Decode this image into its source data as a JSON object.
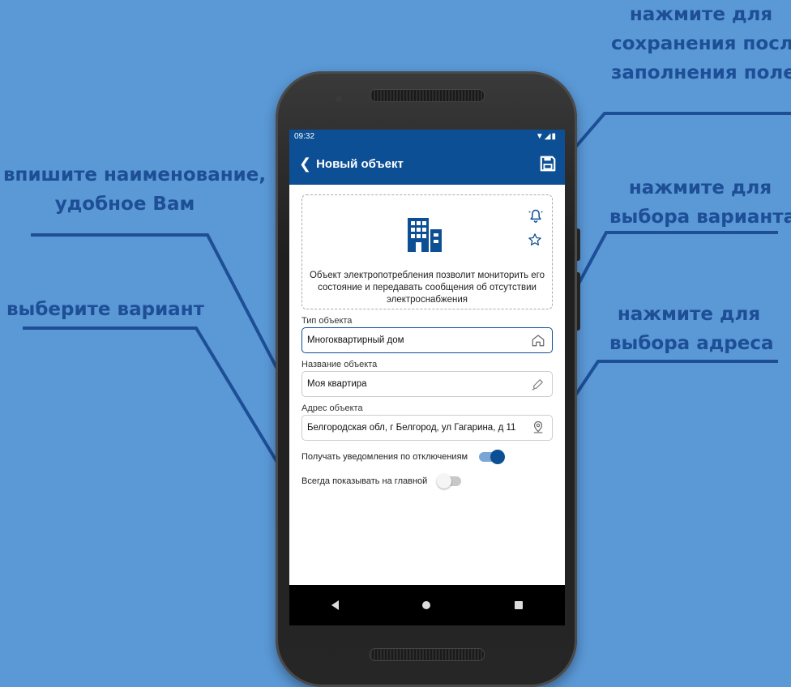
{
  "annotations": {
    "save": [
      "нажмите для",
      "сохранения после",
      "заполнения полей"
    ],
    "name": [
      "впишите наименование,",
      "удобное Вам"
    ],
    "choose": [
      "выберите вариант"
    ],
    "type_choice": [
      "нажмите для",
      "выбора варианта"
    ],
    "address_choice": [
      "нажмите для",
      "выбора адреса"
    ]
  },
  "status_bar": {
    "time": "09:32"
  },
  "app_bar": {
    "title": "Новый объект"
  },
  "info_card": {
    "text": "Объект электропотребления позволит мониторить его состояние и передавать сообщения об отсутствии электроснабжения"
  },
  "fields": {
    "type": {
      "label": "Тип объекта",
      "value": "Многоквартирный дом"
    },
    "name": {
      "label": "Название объекта",
      "value": "Моя квартира"
    },
    "address": {
      "label": "Адрес объекта",
      "value": "Белгородская обл, г Белгород, ул Гагарина, д 11"
    }
  },
  "toggles": {
    "notifications": {
      "label": "Получать уведомления по отключениям",
      "on": true
    },
    "show_main": {
      "label": "Всегда показывать на главной",
      "on": false
    }
  },
  "colors": {
    "background": "#5a98d6",
    "primary": "#0d4f94",
    "annotation_text": "#1d4e96"
  },
  "icons": [
    "back-icon",
    "save-icon",
    "building-icon",
    "bell-icon",
    "star-icon",
    "house-icon",
    "pencil-icon",
    "map-pin-icon"
  ]
}
